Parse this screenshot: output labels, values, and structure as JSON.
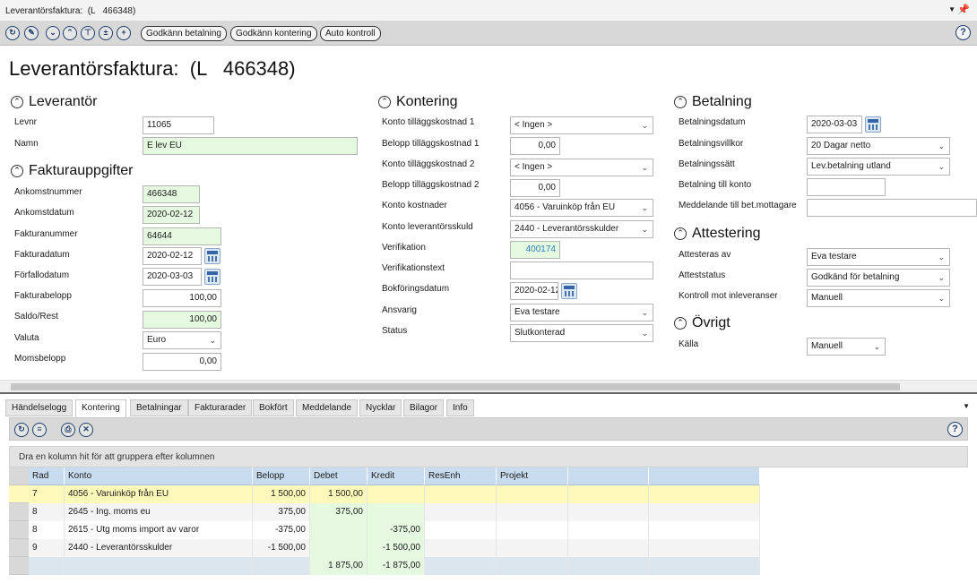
{
  "window": {
    "title": "Leverantörsfaktura:  (L   466348)",
    "pin_icon": "pin-icon",
    "menu_icon": "dropdown-arrow-icon"
  },
  "toolbar": {
    "buttons": [
      "Godkänn betalning",
      "Godkänn kontering",
      "Auto kontroll"
    ],
    "help": "?"
  },
  "page_title": "Leverantörsfaktura:  (L   466348)",
  "leverantor": {
    "heading": "Leverantör",
    "levnr_label": "Levnr",
    "levnr": "11065",
    "namn_label": "Namn",
    "namn": "E          lev EU"
  },
  "faktura": {
    "heading": "Fakturauppgifter",
    "ankomstnummer_label": "Ankomstnummer",
    "ankomstnummer": "466348",
    "ankomstdatum_label": "Ankomstdatum",
    "ankomstdatum": "2020-02-12",
    "fakturanummer_label": "Fakturanummer",
    "fakturanummer": "64644",
    "fakturadatum_label": "Fakturadatum",
    "fakturadatum": "2020-02-12",
    "forfallodatum_label": "Förfallodatum",
    "forfallodatum": "2020-03-03",
    "fakturabelopp_label": "Fakturabelopp",
    "fakturabelopp": "100,00",
    "saldo_label": "Saldo/Rest",
    "saldo": "100,00",
    "valuta_label": "Valuta",
    "valuta": "Euro",
    "momsbelopp_label": "Momsbelopp",
    "momsbelopp": "0,00"
  },
  "kontering": {
    "heading": "Kontering",
    "konto1_label": "Konto tilläggskostnad 1",
    "konto1": "< Ingen >",
    "belopp1_label": "Belopp tilläggskostnad 1",
    "belopp1": "0,00",
    "konto2_label": "Konto tilläggskostnad 2",
    "konto2": "< Ingen >",
    "belopp2_label": "Belopp tilläggskostnad 2",
    "belopp2": "0,00",
    "kostnad_label": "Konto kostnader",
    "kostnad": "4056 - Varuinköp från EU",
    "skuld_label": "Konto leverantörsskuld",
    "skuld": "2440 - Leverantörsskulder",
    "verifikation_label": "Verifikation",
    "verifikation": "400174",
    "veriftext_label": "Verifikationstext",
    "veriftext": "",
    "bokdatum_label": "Bokföringsdatum",
    "bokdatum": "2020-02-12",
    "ansvarig_label": "Ansvarig",
    "ansvarig": "Eva testare",
    "status_label": "Status",
    "status": "Slutkonterad"
  },
  "betalning": {
    "heading": "Betalning",
    "datum_label": "Betalningsdatum",
    "datum": "2020-03-03",
    "villkor_label": "Betalningsvillkor",
    "villkor": "20 Dagar netto",
    "satt_label": "Betalningssätt",
    "satt": "Lev.betalning utland",
    "konto_label": "Betalning till konto",
    "konto": "",
    "meddelande_label": "Meddelande till bet.mottagare",
    "meddelande": ""
  },
  "attestering": {
    "heading": "Attestering",
    "av_label": "Attesteras av",
    "av": "Eva testare",
    "status_label": "Atteststatus",
    "status": "Godkänd för betalning",
    "kontroll_label": "Kontroll mot inleveranser",
    "kontroll": "Manuell"
  },
  "ovrigt": {
    "heading": "Övrigt",
    "kalla_label": "Källa",
    "kalla": "Manuell"
  },
  "tabs": [
    "Händelselogg",
    "Kontering",
    "Betalningar",
    "Fakturarader",
    "Bokfört",
    "Meddelande",
    "Nycklar",
    "Bilagor",
    "Info"
  ],
  "active_tab": "Kontering",
  "grid": {
    "group_hint": "Dra en kolumn hit för att gruppera efter kolumnen",
    "columns": [
      "Rad",
      "Konto",
      "Belopp",
      "Debet",
      "Kredit",
      "ResEnh",
      "Projekt"
    ],
    "rows": [
      {
        "rad": "7",
        "konto": "4056 - Varuinköp från EU",
        "belopp": "1 500,00",
        "debet": "1 500,00",
        "kredit": ""
      },
      {
        "rad": "8",
        "konto": "2645 - Ing. moms eu",
        "belopp": "375,00",
        "debet": "375,00",
        "kredit": ""
      },
      {
        "rad": "8",
        "konto": "2615 - Utg moms import av varor",
        "belopp": "-375,00",
        "debet": "",
        "kredit": "-375,00"
      },
      {
        "rad": "9",
        "konto": "2440 - Leverantörsskulder",
        "belopp": "-1 500,00",
        "debet": "",
        "kredit": "-1 500,00"
      }
    ],
    "totals": {
      "debet": "1 875,00",
      "kredit": "-1 875,00"
    }
  },
  "colors": {
    "green_field": "#e5f9e0",
    "header_blue": "#c9dcef",
    "selected_row": "#fffaba"
  }
}
